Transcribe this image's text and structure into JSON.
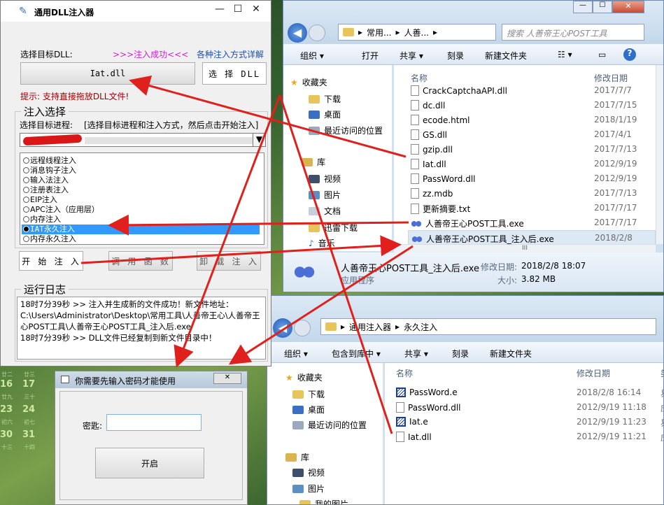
{
  "calendar": {
    "rows": [
      {
        "d1": "16",
        "d2": "17",
        "s1": "",
        "s2": ""
      },
      {
        "d1": "23",
        "d2": "24",
        "s1": "初六",
        "s2": "初七"
      },
      {
        "d1": "30",
        "d2": "31",
        "s1": "十三",
        "s2": "十四"
      }
    ],
    "upper_small": [
      "廿二",
      "廿三"
    ],
    "mid_small": [
      "廿九",
      "三十"
    ],
    "top_digit": "2"
  },
  "tool": {
    "title": "通用DLL注入器",
    "select_dll_label": "选择目标DLL:",
    "status": ">>>注入成功<<<",
    "methods_link": "各种注入方式详解",
    "dll_value": "Iat.dll",
    "select_dll_button": "选 择 DLL",
    "hint": "提示: 支持直接拖放DLL文件!",
    "group_inject": "注入选择",
    "process_label": "选择目标进程:",
    "process_instruction": "[选择目标进程和注入方式，然后点击开始注入]",
    "methods": [
      "远程线程注入",
      "消息钩子注入",
      "输入法注入",
      "注册表注入",
      "EIP注入",
      "APC注入（应用层）",
      "内存注入",
      "IAT永久注入",
      "内存永久注入"
    ],
    "selected_method_index": 7,
    "start_button": "开 始 注 入",
    "call_button": "调 用 函 数",
    "unload_button": "卸 载 注 入",
    "log_group": "运行日志",
    "log_lines": [
      "18时7分39秒 >> 注入并生成新的文件成功！新文件地址：C:\\Users\\Administrator\\Desktop\\常用工具\\人善帝王心\\人善帝王心POST工具\\人善帝王心POST工具_注入后.exe",
      "18时7分39秒 >> DLL文件已经复制到新文件目录中！"
    ]
  },
  "explorer1": {
    "crumbs": [
      "常用...",
      "人善..."
    ],
    "search_placeholder": "搜索 人善帝王心POST工具",
    "commands": [
      "组织 ▾",
      "打开",
      "共享 ▾",
      "刻录",
      "新建文件夹"
    ],
    "nav_items": [
      "收藏夹",
      "下载",
      "桌面",
      "最近访问的位置",
      "库",
      "视频",
      "图片",
      "文档",
      "迅雷下载",
      "音乐"
    ],
    "col_name": "名称",
    "col_date": "修改日期",
    "files": [
      {
        "name": "CrackCaptchaAPI.dll",
        "date": "2017/7/7",
        "type": "dll"
      },
      {
        "name": "dc.dll",
        "date": "2017/7/15",
        "type": "dll"
      },
      {
        "name": "ecode.html",
        "date": "2018/1/19",
        "type": "doc"
      },
      {
        "name": "GS.dll",
        "date": "2017/4/1",
        "type": "dll"
      },
      {
        "name": "gzip.dll",
        "date": "2017/7/13",
        "type": "dll"
      },
      {
        "name": "Iat.dll",
        "date": "2012/9/19",
        "type": "dll"
      },
      {
        "name": "PassWord.dll",
        "date": "2012/9/19",
        "type": "dll"
      },
      {
        "name": "zz.mdb",
        "date": "2017/7/13",
        "type": "doc"
      },
      {
        "name": "更新摘要.txt",
        "date": "2017/7/17",
        "type": "doc"
      },
      {
        "name": "人善帝王心POST工具.exe",
        "date": "2017/7/17",
        "type": "exe"
      },
      {
        "name": "人善帝王心POST工具_注入后.exe",
        "date": "2018/2/8",
        "type": "exe"
      }
    ],
    "details": {
      "name": "人善帝王心POST工具_注入后.exe",
      "kind": "应用程序",
      "date_label": "修改日期:",
      "date_value": "2018/2/8 18:07",
      "size_label": "大小:",
      "size_value": "3.82 MB"
    }
  },
  "explorer2": {
    "crumbs": [
      "通用注入器",
      "永久注入"
    ],
    "commands": [
      "组织 ▾",
      "包含到库中 ▾",
      "共享 ▾",
      "刻录",
      "新建文件夹"
    ],
    "nav_items": [
      "收藏夹",
      "下载",
      "桌面",
      "最近访问的位置",
      "库",
      "视频",
      "图片",
      "我的图片"
    ],
    "col_name": "名称",
    "col_date": "修改日期",
    "col_extra": "类",
    "files": [
      {
        "name": "PassWord.e",
        "date": "2018/2/8 16:14",
        "extra": "易",
        "type": "eb"
      },
      {
        "name": "PassWord.dll",
        "date": "2012/9/19 11:18",
        "extra": "应",
        "type": "dll"
      },
      {
        "name": "Iat.e",
        "date": "2012/9/19 11:23",
        "extra": "易",
        "type": "eb"
      },
      {
        "name": "Iat.dll",
        "date": "2012/9/19 11:21",
        "extra": "应",
        "type": "dll"
      }
    ]
  },
  "password_dialog": {
    "title": "你需要先输入密码才能使用",
    "label": "密匙:",
    "input_value": "",
    "button": "开启"
  },
  "colors": {
    "arrow": "#e0201c",
    "status": "#d020d0",
    "link": "#1a4fb0",
    "hint": "#a00000",
    "selection": "#3399ff"
  }
}
